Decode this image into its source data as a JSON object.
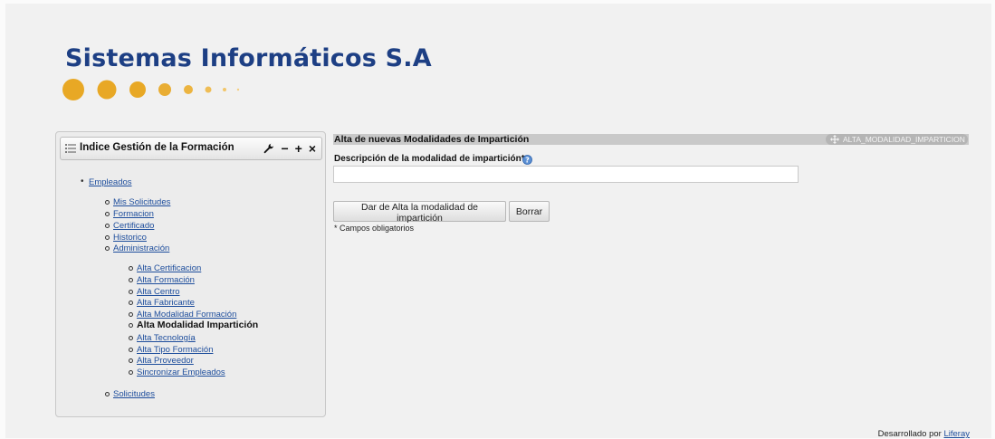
{
  "logo": {
    "title": "Sistemas Informáticos S.A",
    "color": "#1d3f84",
    "dot_color": "#e8a825"
  },
  "portlet": {
    "title": "Indice Gestión de la Formación",
    "actions": [
      "wrench-icon",
      "minimize-icon",
      "add-icon",
      "close-icon"
    ],
    "minimize": "−",
    "add": "+",
    "close": "×"
  },
  "nav": {
    "empleados": "Empleados",
    "sub": {
      "mis_solicitudes": "Mis Solicitudes",
      "formacion": "Formacion",
      "certificado": "Certificado",
      "historico": "Historico",
      "administracion": "Administración",
      "solicitudes": "Solicitudes"
    },
    "admin": {
      "alta_certificacion": "Alta Certificacion",
      "alta_formacion": "Alta Formación",
      "alta_centro": "Alta Centro",
      "alta_fabricante": "Alta Fabricante",
      "alta_modalidad_formacion": "Alta Modalidad Formación",
      "alta_modalidad_imparticion": "Alta Modalidad Impartición",
      "alta_tecnologia": "Alta Tecnología",
      "alta_tipo_formacion": "Alta Tipo Formación",
      "alta_proveedor": "Alta Proveedor",
      "sincronizar_empleados": "Sincronizar Empleados"
    }
  },
  "main": {
    "section_title": "Alta de nuevas Modalidades de Impartición",
    "portlet_id": "ALTA_MODALIDAD_IMPARTICION",
    "field_label": "Descripción de la modalidad de impartición* :",
    "field_value": "",
    "submit_label": "Dar de Alta la modalidad de impartición",
    "reset_label": "Borrar",
    "required_note": "* Campos obligatorios"
  },
  "footer": {
    "text": "Desarrollado por",
    "link": "Liferay"
  }
}
